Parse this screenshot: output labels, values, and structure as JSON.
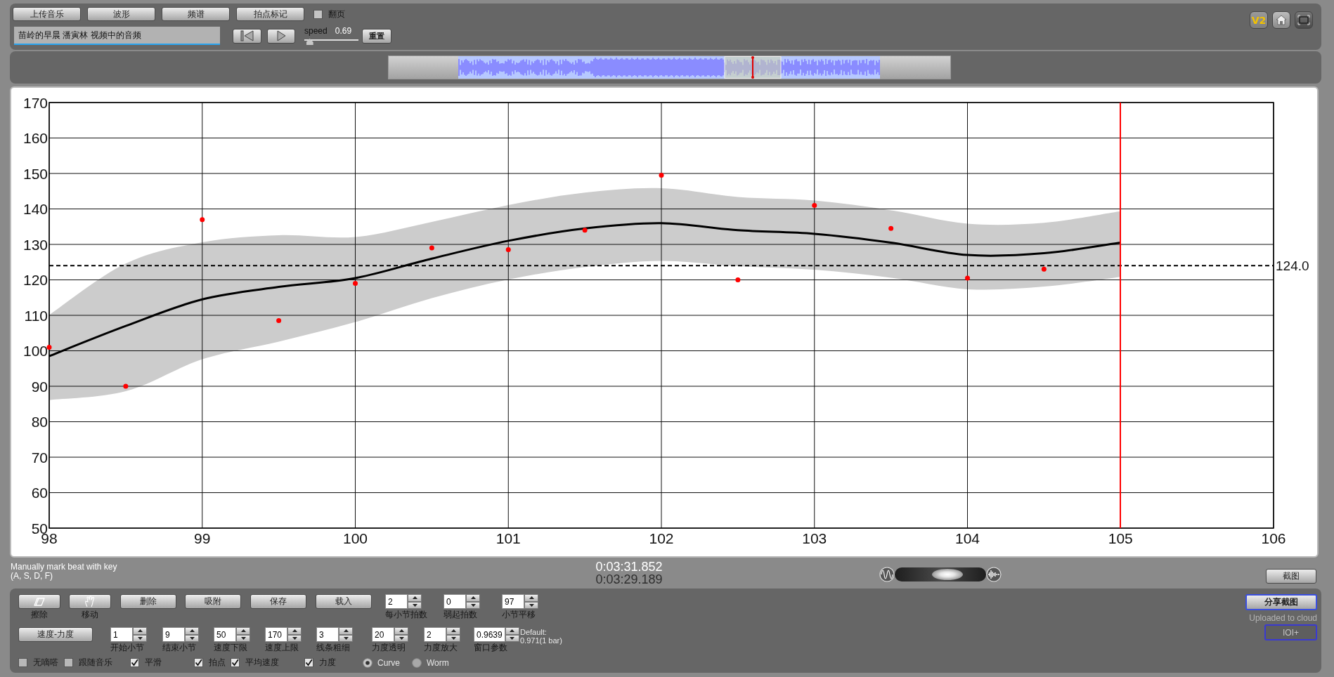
{
  "toolbar": {
    "buttons": [
      "上传音乐",
      "波形",
      "频谱",
      "拍点标记"
    ],
    "page_turn": {
      "label": "翻页",
      "checked": false
    },
    "version_button": "V2"
  },
  "player": {
    "track_name": "苗岭的早晨 潘寅林 视频中的音频",
    "speed": {
      "label": "speed",
      "reading": "0.69",
      "level": 0.1
    },
    "reset_button": "重置"
  },
  "chart": {
    "chart_data": {
      "type": "line",
      "x": [
        98,
        98.5,
        99,
        99.5,
        100,
        100.5,
        101,
        101.5,
        102,
        102.5,
        103,
        103.5,
        104,
        104.5,
        105
      ],
      "series": [
        {
          "type": "line",
          "color": "#000000",
          "values": [
            98.5,
            107,
            114.5,
            118,
            120.5,
            126,
            131,
            134.5,
            136,
            134,
            133,
            130.5,
            127,
            127.5,
            130.5
          ]
        },
        {
          "type": "scatter",
          "color": "#ff0000",
          "values": [
            101,
            90,
            137,
            108.5,
            119,
            129,
            128.5,
            134,
            149.5,
            120,
            141,
            134.5,
            120.5,
            123,
            null
          ]
        }
      ],
      "ref_lines": [
        {
          "axis": "y",
          "value": 124,
          "label": "124.0",
          "color": "#000000"
        },
        {
          "axis": "x",
          "value": 105,
          "color": "#ff0000"
        }
      ],
      "grid": true,
      "xlim": [
        98,
        106
      ],
      "ylim": [
        50,
        170
      ],
      "xticks": [
        98,
        99,
        100,
        101,
        102,
        103,
        104,
        105,
        106
      ],
      "yticks": [
        50,
        60,
        70,
        80,
        90,
        100,
        110,
        120,
        130,
        140,
        150,
        160,
        170
      ]
    }
  },
  "status": {
    "hint": [
      "Manually mark beat with key",
      "(A, S, D, F)"
    ],
    "times": [
      "0:03:31.852",
      "0:03:29.189"
    ],
    "blend": {
      "level": 0.58
    },
    "screenshot_button": "截图"
  },
  "controls": {
    "tool_buttons": [
      "擦除",
      "移动"
    ],
    "action_buttons": [
      "删除",
      "吸附",
      "保存",
      "载入"
    ],
    "beat_fields": [
      {
        "label": "每小节拍数",
        "value": "2"
      },
      {
        "label": "弱起拍数",
        "value": "0"
      },
      {
        "label": "小节平移",
        "value": "97"
      }
    ],
    "mode_button": "速度-力度",
    "range_fields": [
      {
        "label": "开始小节",
        "value": "1"
      },
      {
        "label": "结束小节",
        "value": "9"
      },
      {
        "label": "速度下限",
        "value": "50"
      },
      {
        "label": "速度上限",
        "value": "170"
      },
      {
        "label": "线条粗细",
        "value": "3"
      },
      {
        "label": "力度透明",
        "value": "20"
      },
      {
        "label": "力度放大",
        "value": "2"
      },
      {
        "label": "窗口参数",
        "value": "0.9639"
      }
    ],
    "default_note": [
      "Default:",
      "0.971(1 bar)"
    ],
    "options": [
      {
        "label": "无嘀嗒",
        "checked": false
      },
      {
        "label": "跟随音乐",
        "checked": false
      },
      {
        "label": "平滑",
        "checked": true
      },
      {
        "label": "拍点",
        "checked": true
      },
      {
        "label": "平均速度",
        "checked": true
      },
      {
        "label": "力度",
        "checked": true
      }
    ],
    "plot_styles": [
      {
        "label": "Curve",
        "selected": true
      },
      {
        "label": "Worm",
        "selected": false
      }
    ]
  },
  "share": {
    "button": "分享截图",
    "note": "Uploaded to cloud",
    "upload_button": {
      "label": "IOI+",
      "disabled": true
    }
  }
}
